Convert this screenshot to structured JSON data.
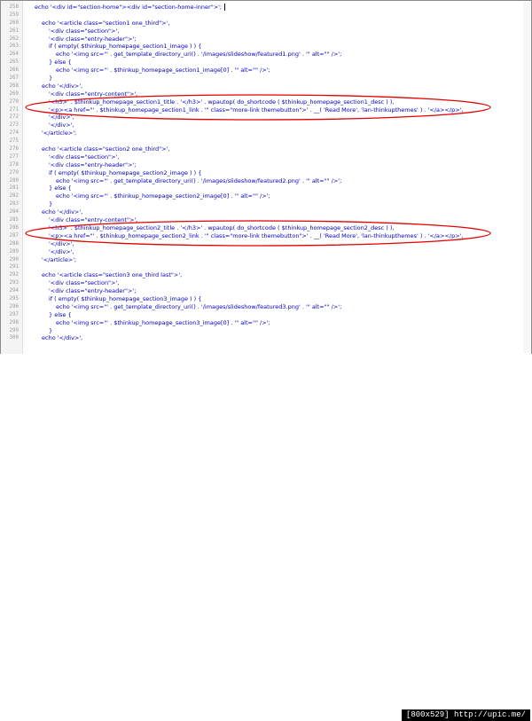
{
  "editor": {
    "lines": [
      {
        "n": "258",
        "text": "echo '<div id=\"section-home\"><div id=\"section-home-inner\">';",
        "indent": 0,
        "cursor": true
      },
      {
        "n": "259",
        "text": "",
        "indent": 0
      },
      {
        "n": "260",
        "text": "echo '<article class=\"section1 one_third\">',",
        "indent": 1
      },
      {
        "n": "261",
        "text": "'<div class=\"section\">',",
        "indent": 2
      },
      {
        "n": "262",
        "text": "'<div class=\"entry-header\">';",
        "indent": 2
      },
      {
        "n": "263",
        "text": "if ( empty( $thinkup_homepage_section1_image ) ) {",
        "indent": 2
      },
      {
        "n": "264",
        "text": "echo '<img src=\"' . get_template_directory_uri() . '/images/slideshow/featured1.png' . '\" alt=\"\" />';",
        "indent": 3
      },
      {
        "n": "265",
        "text": "} else {",
        "indent": 2
      },
      {
        "n": "266",
        "text": "echo '<img src=\"' . $thinkup_homepage_section1_image[0] . '\" alt=\"\" />';",
        "indent": 3
      },
      {
        "n": "267",
        "text": "}",
        "indent": 2
      },
      {
        "n": "268",
        "text": "echo '</div>',",
        "indent": 1
      },
      {
        "n": "269",
        "text": "'<div class=\"entry-content\">',",
        "indent": 2
      },
      {
        "n": "270",
        "text": "'<h3>' . $thinkup_homepage_section1_title . '</h3>' . wpautop( do_shortcode ( $thinkup_homepage_section1_desc ) ),",
        "indent": 2
      },
      {
        "n": "271",
        "text": "'<p><a href=\"' . $thinkup_homepage_section1_link . '\" class=\"more-link themebutton\">' . __( 'Read More', 'lan-thinkupthemes' ) . '</a></p>',",
        "indent": 2
      },
      {
        "n": "272",
        "text": "'</div>',",
        "indent": 2
      },
      {
        "n": "273",
        "text": "'</div>',",
        "indent": 2
      },
      {
        "n": "274",
        "text": "'</article>';",
        "indent": 1
      },
      {
        "n": "275",
        "text": "",
        "indent": 0
      },
      {
        "n": "276",
        "text": "echo '<article class=\"section2 one_third\">',",
        "indent": 1
      },
      {
        "n": "277",
        "text": "'<div class=\"section\">',",
        "indent": 2
      },
      {
        "n": "278",
        "text": "'<div class=\"entry-header\">';",
        "indent": 2
      },
      {
        "n": "279",
        "text": "if ( empty( $thinkup_homepage_section2_image ) ) {",
        "indent": 2
      },
      {
        "n": "280",
        "text": "echo '<img src=\"' . get_template_directory_uri() . '/images/slideshow/featured2.png' . '\" alt=\"\" />';",
        "indent": 3
      },
      {
        "n": "281",
        "text": "} else {",
        "indent": 2
      },
      {
        "n": "282",
        "text": "echo '<img src=\"' . $thinkup_homepage_section2_image[0] . '\" alt=\"\" />';",
        "indent": 3
      },
      {
        "n": "283",
        "text": "}",
        "indent": 2
      },
      {
        "n": "284",
        "text": "echo '</div>',",
        "indent": 1
      },
      {
        "n": "285",
        "text": "'<div class=\"entry-content\">',",
        "indent": 2
      },
      {
        "n": "286",
        "text": "'<h3>' . $thinkup_homepage_section2_title . '</h3>' . wpautop( do_shortcode ( $thinkup_homepage_section2_desc ) ),",
        "indent": 2
      },
      {
        "n": "287",
        "text": "'<p><a href=\"' . $thinkup_homepage_section2_link . '\" class=\"more-link themebutton\">' . __( 'Read More', 'lan-thinkupthemes' ) . '</a></p>',",
        "indent": 2
      },
      {
        "n": "288",
        "text": "'</div>',",
        "indent": 2
      },
      {
        "n": "289",
        "text": "'</div>',",
        "indent": 2
      },
      {
        "n": "290",
        "text": "'</article>';",
        "indent": 1
      },
      {
        "n": "291",
        "text": "",
        "indent": 0
      },
      {
        "n": "292",
        "text": "echo '<article class=\"section3 one_third last\">',",
        "indent": 1
      },
      {
        "n": "293",
        "text": "'<div class=\"section\">',",
        "indent": 2
      },
      {
        "n": "294",
        "text": "'<div class=\"entry-header\">';",
        "indent": 2
      },
      {
        "n": "295",
        "text": "if ( empty( $thinkup_homepage_section3_image ) ) {",
        "indent": 2
      },
      {
        "n": "296",
        "text": "echo '<img src=\"' . get_template_directory_uri() . '/images/slideshow/featured3.png' . '\" alt=\"\" />';",
        "indent": 3
      },
      {
        "n": "297",
        "text": "} else {",
        "indent": 2
      },
      {
        "n": "298",
        "text": "echo '<img src=\"' . $thinkup_homepage_section3_image[0] . '\" alt=\"\" />';",
        "indent": 3
      },
      {
        "n": "299",
        "text": "}",
        "indent": 2
      },
      {
        "n": "300",
        "text": "echo '</div>',",
        "indent": 1
      }
    ]
  },
  "highlights": [
    {
      "lines": [
        "270",
        "271"
      ],
      "color": "#e00000"
    },
    {
      "lines": [
        "286",
        "287"
      ],
      "color": "#e00000"
    }
  ],
  "colors": {
    "code": "#0000c8",
    "line_number": "#9a9a9a",
    "annotation": "#e00000"
  },
  "watermark": {
    "text": "[800x529] http://upic.me/"
  }
}
